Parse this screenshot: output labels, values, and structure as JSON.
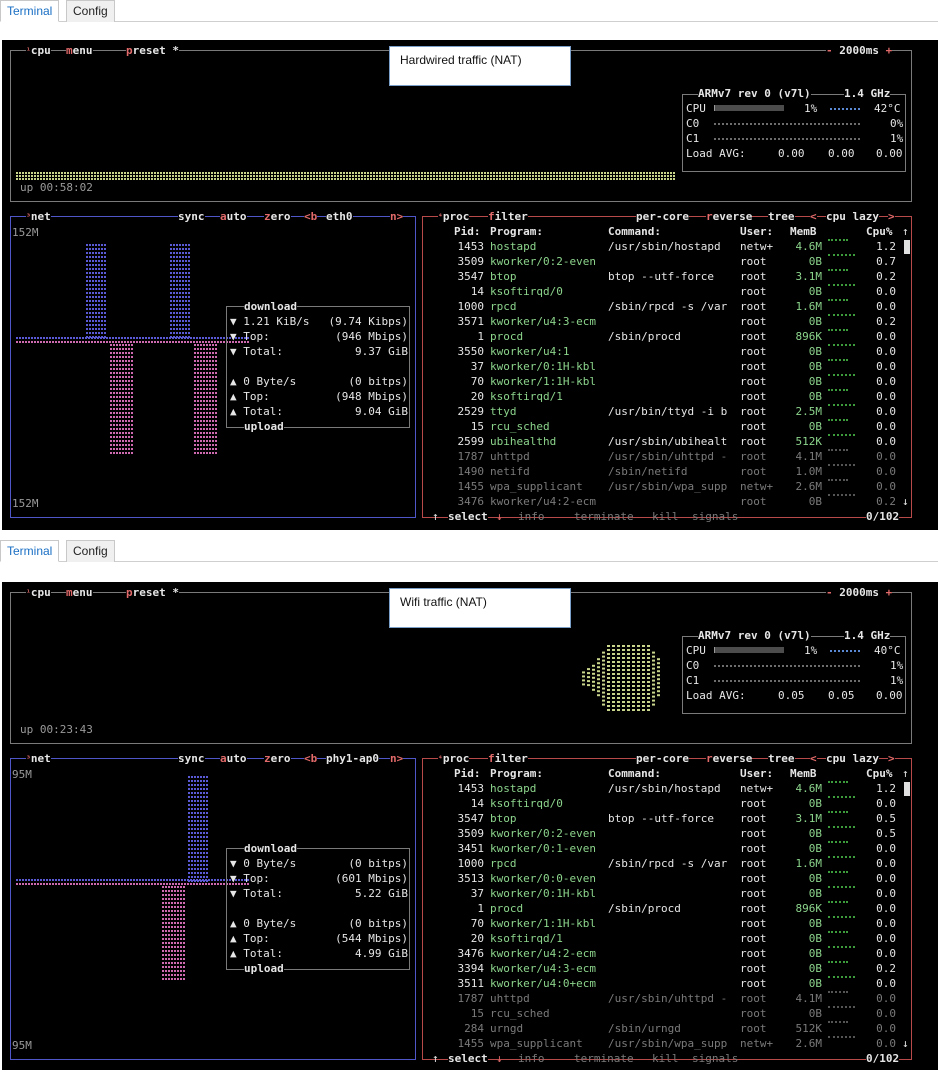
{
  "screens": [
    {
      "tabs": [
        {
          "label": "Terminal",
          "active": true
        },
        {
          "label": "Config",
          "active": false
        }
      ],
      "annotation": "Hardwired traffic (NAT)",
      "cpu_box": {
        "header": {
          "cpu": "cpu",
          "menu": "menu",
          "preset": "preset *",
          "interval": "2000ms",
          "minus": "-",
          "plus": "+"
        },
        "uptime": "up 00:58:02",
        "model": "ARMv7 rev 0 (v7l)",
        "freq": "1.4 GHz",
        "cpu_label": "CPU",
        "cpu_pct": "1%",
        "cpu_pct_value": 1,
        "temp": "42°C",
        "cores": [
          {
            "label": "C0",
            "pct": "0%"
          },
          {
            "label": "C1",
            "pct": "1%"
          }
        ],
        "load_label": "Load AVG:",
        "load": [
          "0.00",
          "0.00",
          "0.00"
        ]
      },
      "net_box": {
        "header": {
          "net": "net",
          "sync": "sync",
          "auto": "auto",
          "zero": "zero",
          "b": "<b",
          "iface": "eth0",
          "n": "n>"
        },
        "scale_top": "152M",
        "scale_bottom": "152M",
        "download_label": "download",
        "download": {
          "rate": "▼ 1.21 KiB/s",
          "rate_bits": "(9.74 Kibps)",
          "top": "▼ Top:",
          "top_val": "(946 Mbips)",
          "total": "▼ Total:",
          "total_val": "9.37 GiB"
        },
        "upload": {
          "rate": "▲ 0 Byte/s",
          "rate_bits": "(0 bitps)",
          "top": "▲ Top:",
          "top_val": "(948 Mbips)",
          "total": "▲ Total:",
          "total_val": "9.04 GiB"
        },
        "upload_label": "upload"
      },
      "proc_box": {
        "header": {
          "proc": "proc",
          "filter": "filter",
          "percore": "per-core",
          "reverse": "reverse",
          "tree": "tree",
          "lt": "<",
          "sort": "cpu lazy",
          "gt": ">"
        },
        "columns": {
          "pid": "Pid:",
          "program": "Program:",
          "command": "Command:",
          "user": "User:",
          "mem": "MemB",
          "cpu": "Cpu%"
        },
        "rows": [
          {
            "pid": "1453",
            "program": "hostapd",
            "command": "/usr/sbin/hostapd",
            "user": "netw+",
            "mem": "4.6M",
            "cpu": "1.2"
          },
          {
            "pid": "3509",
            "program": "kworker/0:2-even",
            "command": "",
            "user": "root",
            "mem": "0B",
            "cpu": "0.7"
          },
          {
            "pid": "3547",
            "program": "btop",
            "command": "btop --utf-force",
            "user": "root",
            "mem": "3.1M",
            "cpu": "0.2"
          },
          {
            "pid": "14",
            "program": "ksoftirqd/0",
            "command": "",
            "user": "root",
            "mem": "0B",
            "cpu": "0.0"
          },
          {
            "pid": "1000",
            "program": "rpcd",
            "command": "/sbin/rpcd -s /var",
            "user": "root",
            "mem": "1.6M",
            "cpu": "0.0"
          },
          {
            "pid": "3571",
            "program": "kworker/u4:3-ecm",
            "command": "",
            "user": "root",
            "mem": "0B",
            "cpu": "0.2"
          },
          {
            "pid": "1",
            "program": "procd",
            "command": "/sbin/procd",
            "user": "root",
            "mem": "896K",
            "cpu": "0.0"
          },
          {
            "pid": "3550",
            "program": "kworker/u4:1",
            "command": "",
            "user": "root",
            "mem": "0B",
            "cpu": "0.0"
          },
          {
            "pid": "37",
            "program": "kworker/0:1H-kbl",
            "command": "",
            "user": "root",
            "mem": "0B",
            "cpu": "0.0"
          },
          {
            "pid": "70",
            "program": "kworker/1:1H-kbl",
            "command": "",
            "user": "root",
            "mem": "0B",
            "cpu": "0.0"
          },
          {
            "pid": "20",
            "program": "ksoftirqd/1",
            "command": "",
            "user": "root",
            "mem": "0B",
            "cpu": "0.0"
          },
          {
            "pid": "2529",
            "program": "ttyd",
            "command": "/usr/bin/ttyd -i b",
            "user": "root",
            "mem": "2.5M",
            "cpu": "0.0"
          },
          {
            "pid": "15",
            "program": "rcu_sched",
            "command": "",
            "user": "root",
            "mem": "0B",
            "cpu": "0.0"
          },
          {
            "pid": "2599",
            "program": "ubihealthd",
            "command": "/usr/sbin/ubihealt",
            "user": "root",
            "mem": "512K",
            "cpu": "0.0"
          },
          {
            "pid": "1787",
            "program": "uhttpd",
            "command": "/usr/sbin/uhttpd -",
            "user": "root",
            "mem": "4.1M",
            "cpu": "0.0"
          },
          {
            "pid": "1490",
            "program": "netifd",
            "command": "/sbin/netifd",
            "user": "root",
            "mem": "1.0M",
            "cpu": "0.0"
          },
          {
            "pid": "1455",
            "program": "wpa_supplicant",
            "command": "/usr/sbin/wpa_supp",
            "user": "netw+",
            "mem": "2.6M",
            "cpu": "0.0"
          },
          {
            "pid": "3476",
            "program": "kworker/u4:2-ecm",
            "command": "",
            "user": "root",
            "mem": "0B",
            "cpu": "0.2"
          }
        ],
        "footer": {
          "select": "select",
          "info": "info",
          "terminate": "terminate",
          "kill": "kill",
          "signals": "signals",
          "count": "0/102"
        }
      }
    },
    {
      "tabs": [
        {
          "label": "Terminal",
          "active": true
        },
        {
          "label": "Config",
          "active": false
        }
      ],
      "annotation": "Wifi traffic (NAT)",
      "cpu_box": {
        "header": {
          "cpu": "cpu",
          "menu": "menu",
          "preset": "preset *",
          "interval": "2000ms",
          "minus": "-",
          "plus": "+"
        },
        "uptime": "up 00:23:43",
        "model": "ARMv7 rev 0 (v7l)",
        "freq": "1.4 GHz",
        "cpu_label": "CPU",
        "cpu_pct": "1%",
        "cpu_pct_value": 1,
        "temp": "40°C",
        "cores": [
          {
            "label": "C0",
            "pct": "1%"
          },
          {
            "label": "C1",
            "pct": "1%"
          }
        ],
        "load_label": "Load AVG:",
        "load": [
          "0.05",
          "0.05",
          "0.00"
        ]
      },
      "net_box": {
        "header": {
          "net": "net",
          "sync": "sync",
          "auto": "auto",
          "zero": "zero",
          "b": "<b",
          "iface": "phy1-ap0",
          "n": "n>"
        },
        "scale_top": "95M",
        "scale_bottom": "95M",
        "download_label": "download",
        "download": {
          "rate": "▼ 0 Byte/s",
          "rate_bits": "(0 bitps)",
          "top": "▼ Top:",
          "top_val": "(601 Mbips)",
          "total": "▼ Total:",
          "total_val": "5.22 GiB"
        },
        "upload": {
          "rate": "▲ 0 Byte/s",
          "rate_bits": "(0 bitps)",
          "top": "▲ Top:",
          "top_val": "(544 Mbips)",
          "total": "▲ Total:",
          "total_val": "4.99 GiB"
        },
        "upload_label": "upload"
      },
      "proc_box": {
        "header": {
          "proc": "proc",
          "filter": "filter",
          "percore": "per-core",
          "reverse": "reverse",
          "tree": "tree",
          "lt": "<",
          "sort": "cpu lazy",
          "gt": ">"
        },
        "columns": {
          "pid": "Pid:",
          "program": "Program:",
          "command": "Command:",
          "user": "User:",
          "mem": "MemB",
          "cpu": "Cpu%"
        },
        "rows": [
          {
            "pid": "1453",
            "program": "hostapd",
            "command": "/usr/sbin/hostapd",
            "user": "netw+",
            "mem": "4.6M",
            "cpu": "1.2"
          },
          {
            "pid": "14",
            "program": "ksoftirqd/0",
            "command": "",
            "user": "root",
            "mem": "0B",
            "cpu": "0.0"
          },
          {
            "pid": "3547",
            "program": "btop",
            "command": "btop --utf-force",
            "user": "root",
            "mem": "3.1M",
            "cpu": "0.5"
          },
          {
            "pid": "3509",
            "program": "kworker/0:2-even",
            "command": "",
            "user": "root",
            "mem": "0B",
            "cpu": "0.5"
          },
          {
            "pid": "3451",
            "program": "kworker/0:1-even",
            "command": "",
            "user": "root",
            "mem": "0B",
            "cpu": "0.0"
          },
          {
            "pid": "1000",
            "program": "rpcd",
            "command": "/sbin/rpcd -s /var",
            "user": "root",
            "mem": "1.6M",
            "cpu": "0.0"
          },
          {
            "pid": "3513",
            "program": "kworker/0:0-even",
            "command": "",
            "user": "root",
            "mem": "0B",
            "cpu": "0.0"
          },
          {
            "pid": "37",
            "program": "kworker/0:1H-kbl",
            "command": "",
            "user": "root",
            "mem": "0B",
            "cpu": "0.0"
          },
          {
            "pid": "1",
            "program": "procd",
            "command": "/sbin/procd",
            "user": "root",
            "mem": "896K",
            "cpu": "0.0"
          },
          {
            "pid": "70",
            "program": "kworker/1:1H-kbl",
            "command": "",
            "user": "root",
            "mem": "0B",
            "cpu": "0.0"
          },
          {
            "pid": "20",
            "program": "ksoftirqd/1",
            "command": "",
            "user": "root",
            "mem": "0B",
            "cpu": "0.0"
          },
          {
            "pid": "3476",
            "program": "kworker/u4:2-ecm",
            "command": "",
            "user": "root",
            "mem": "0B",
            "cpu": "0.0"
          },
          {
            "pid": "3394",
            "program": "kworker/u4:3-ecm",
            "command": "",
            "user": "root",
            "mem": "0B",
            "cpu": "0.2"
          },
          {
            "pid": "3511",
            "program": "kworker/u4:0+ecm",
            "command": "",
            "user": "root",
            "mem": "0B",
            "cpu": "0.0"
          },
          {
            "pid": "1787",
            "program": "uhttpd",
            "command": "/usr/sbin/uhttpd -",
            "user": "root",
            "mem": "4.1M",
            "cpu": "0.0"
          },
          {
            "pid": "15",
            "program": "rcu_sched",
            "command": "",
            "user": "root",
            "mem": "0B",
            "cpu": "0.0"
          },
          {
            "pid": "284",
            "program": "urngd",
            "command": "/sbin/urngd",
            "user": "root",
            "mem": "512K",
            "cpu": "0.0"
          },
          {
            "pid": "1455",
            "program": "wpa_supplicant",
            "command": "/usr/sbin/wpa_supp",
            "user": "netw+",
            "mem": "2.6M",
            "cpu": "0.0"
          }
        ],
        "footer": {
          "select": "select",
          "info": "info",
          "terminate": "terminate",
          "kill": "kill",
          "signals": "signals",
          "count": "0/102"
        }
      }
    }
  ],
  "colors": {
    "accent": "#e26a6a",
    "process_green": "#8cd48c",
    "cpu_graph": "#c9d58a",
    "net_download": "#5a5ad6",
    "net_upload": "#d06ab0",
    "terminal_bg": "#000000",
    "tab_active": "#1a6fc4"
  }
}
